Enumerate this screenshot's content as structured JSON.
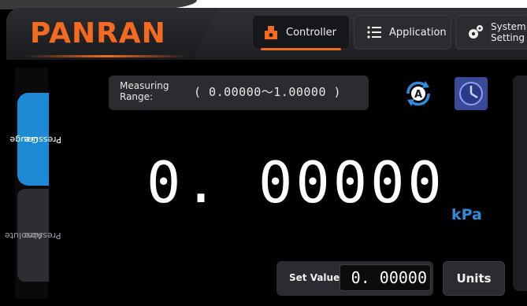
{
  "header": {
    "logo": "PANRAN",
    "tabs": [
      {
        "label": "Controller",
        "icon": "controller-icon",
        "active": true
      },
      {
        "label": "Application",
        "icon": "list-icon",
        "active": false
      },
      {
        "label_line1": "System",
        "label_line2": "Setting",
        "icon": "gears-icon",
        "active": false
      }
    ]
  },
  "side_tabs": [
    {
      "line1": "Gauge",
      "line2": "Pressure",
      "active": true
    },
    {
      "line1": "Absolute",
      "line2": "Pressure",
      "active": false
    }
  ],
  "range": {
    "label_line1": "Measuring",
    "label_line2": "Range:",
    "value": "( 0.00000～1.00000 )"
  },
  "icons": {
    "auto": "auto-mode-icon",
    "timer": "clock-icon"
  },
  "reading": {
    "value": "0. 00000",
    "unit": "kPa"
  },
  "set_value": {
    "label": "Set Value",
    "value": "0. 00000"
  },
  "units_button": {
    "label": "Units"
  },
  "colors": {
    "accent": "#f46a21",
    "blue": "#1e8ad6",
    "unit": "#2a8de0"
  }
}
